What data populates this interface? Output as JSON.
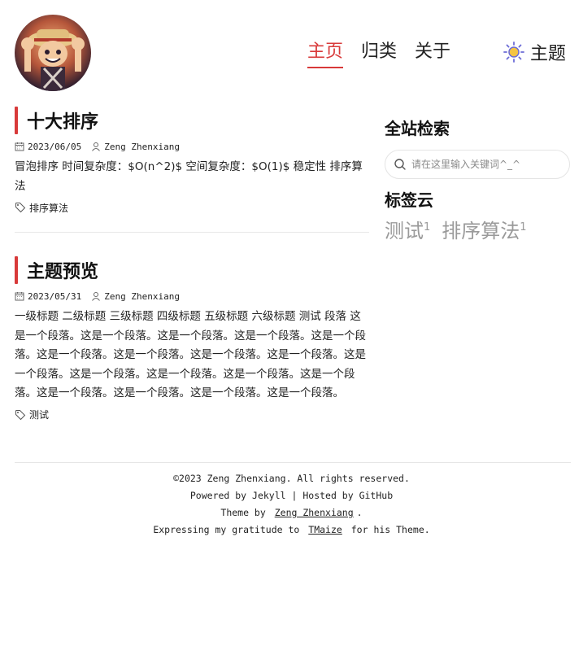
{
  "header": {
    "nav": [
      {
        "label": "主页",
        "active": true
      },
      {
        "label": "归类",
        "active": false
      },
      {
        "label": "关于",
        "active": false
      }
    ],
    "theme_label": "主题",
    "accent_color": "#d83a3a"
  },
  "posts": [
    {
      "title": "十大排序",
      "date": "2023/06/05",
      "author": "Zeng Zhenxiang",
      "excerpt": "冒泡排序 时间复杂度：$O(n^2)$ 空间复杂度：$O(1)$ 稳定性 排序算法",
      "tag": "排序算法"
    },
    {
      "title": "主题预览",
      "date": "2023/05/31",
      "author": "Zeng Zhenxiang",
      "excerpt": "一级标题 二级标题 三级标题 四级标题 五级标题 六级标题 测试 段落 这是一个段落。这是一个段落。这是一个段落。这是一个段落。这是一个段落。这是一个段落。这是一个段落。这是一个段落。这是一个段落。这是一个段落。这是一个段落。这是一个段落。这是一个段落。这是一个段落。这是一个段落。这是一个段落。这是一个段落。这是一个段落。",
      "tag": "测试"
    }
  ],
  "sidebar": {
    "search_title": "全站检索",
    "search_placeholder": "请在这里输入关键词^_^",
    "tagcloud_title": "标签云",
    "tags": [
      {
        "label": "测试",
        "count": "1"
      },
      {
        "label": "排序算法",
        "count": "1"
      }
    ]
  },
  "footer": {
    "copyright": "©2023 Zeng Zhenxiang. All rights reserved.",
    "powered": "Powered by Jekyll | Hosted by GitHub",
    "theme_prefix": "Theme by",
    "theme_author": "Zeng Zhenxiang",
    "theme_suffix": ".",
    "thanks_prefix": "Expressing my gratitude to",
    "thanks_link": "TMaize",
    "thanks_suffix": "for his Theme."
  }
}
